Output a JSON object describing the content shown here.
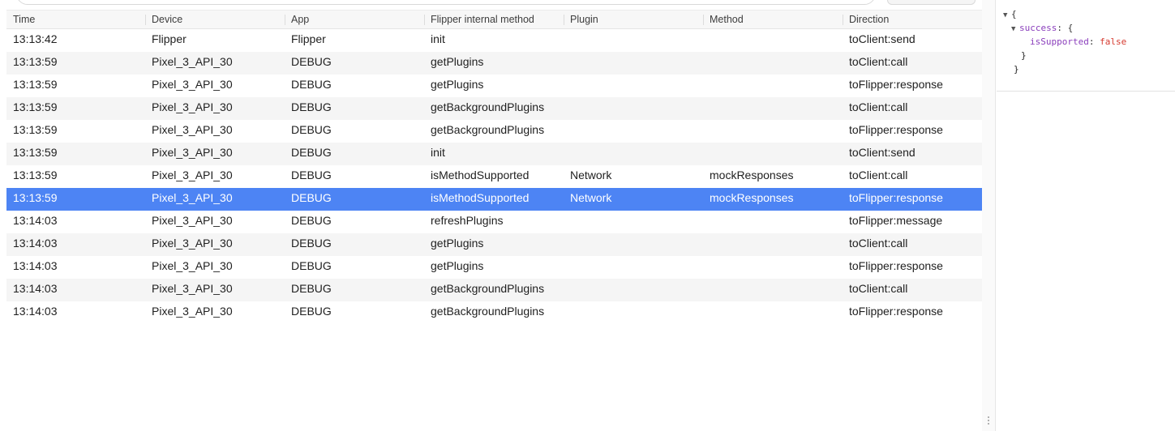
{
  "table": {
    "columns": [
      "Time",
      "Device",
      "App",
      "Flipper internal method",
      "Plugin",
      "Method",
      "Direction"
    ],
    "rows": [
      {
        "time": "13:13:42",
        "device": "Flipper",
        "app": "Flipper",
        "internal_method": "init",
        "plugin": "",
        "method": "",
        "direction": "toClient:send"
      },
      {
        "time": "13:13:59",
        "device": "Pixel_3_API_30",
        "app": "DEBUG",
        "internal_method": "getPlugins",
        "plugin": "",
        "method": "",
        "direction": "toClient:call"
      },
      {
        "time": "13:13:59",
        "device": "Pixel_3_API_30",
        "app": "DEBUG",
        "internal_method": "getPlugins",
        "plugin": "",
        "method": "",
        "direction": "toFlipper:response"
      },
      {
        "time": "13:13:59",
        "device": "Pixel_3_API_30",
        "app": "DEBUG",
        "internal_method": "getBackgroundPlugins",
        "plugin": "",
        "method": "",
        "direction": "toClient:call"
      },
      {
        "time": "13:13:59",
        "device": "Pixel_3_API_30",
        "app": "DEBUG",
        "internal_method": "getBackgroundPlugins",
        "plugin": "",
        "method": "",
        "direction": "toFlipper:response"
      },
      {
        "time": "13:13:59",
        "device": "Pixel_3_API_30",
        "app": "DEBUG",
        "internal_method": "init",
        "plugin": "",
        "method": "",
        "direction": "toClient:send"
      },
      {
        "time": "13:13:59",
        "device": "Pixel_3_API_30",
        "app": "DEBUG",
        "internal_method": "isMethodSupported",
        "plugin": "Network",
        "method": "mockResponses",
        "direction": "toClient:call"
      },
      {
        "time": "13:13:59",
        "device": "Pixel_3_API_30",
        "app": "DEBUG",
        "internal_method": "isMethodSupported",
        "plugin": "Network",
        "method": "mockResponses",
        "direction": "toFlipper:response",
        "selected": true
      },
      {
        "time": "13:14:03",
        "device": "Pixel_3_API_30",
        "app": "DEBUG",
        "internal_method": "refreshPlugins",
        "plugin": "",
        "method": "",
        "direction": "toFlipper:message"
      },
      {
        "time": "13:14:03",
        "device": "Pixel_3_API_30",
        "app": "DEBUG",
        "internal_method": "getPlugins",
        "plugin": "",
        "method": "",
        "direction": "toClient:call"
      },
      {
        "time": "13:14:03",
        "device": "Pixel_3_API_30",
        "app": "DEBUG",
        "internal_method": "getPlugins",
        "plugin": "",
        "method": "",
        "direction": "toFlipper:response"
      },
      {
        "time": "13:14:03",
        "device": "Pixel_3_API_30",
        "app": "DEBUG",
        "internal_method": "getBackgroundPlugins",
        "plugin": "",
        "method": "",
        "direction": "toClient:call"
      },
      {
        "time": "13:14:03",
        "device": "Pixel_3_API_30",
        "app": "DEBUG",
        "internal_method": "getBackgroundPlugins",
        "plugin": "",
        "method": "",
        "direction": "toFlipper:response"
      }
    ]
  },
  "json_view": {
    "open_brace": "{",
    "key_success": "success",
    "colon_open": ": {",
    "key_is_supported": "isSupported",
    "colon": ": ",
    "value_is_supported": "false",
    "close_inner": "}",
    "close_outer": "}"
  },
  "colors": {
    "selected_row": "#4d84f4",
    "alt_row": "#f5f5f5",
    "json_key": "#8a3ebc",
    "json_bool": "#d63a2f"
  },
  "icons": [
    "expand-triangle-icon",
    "drag-handle-icon"
  ]
}
